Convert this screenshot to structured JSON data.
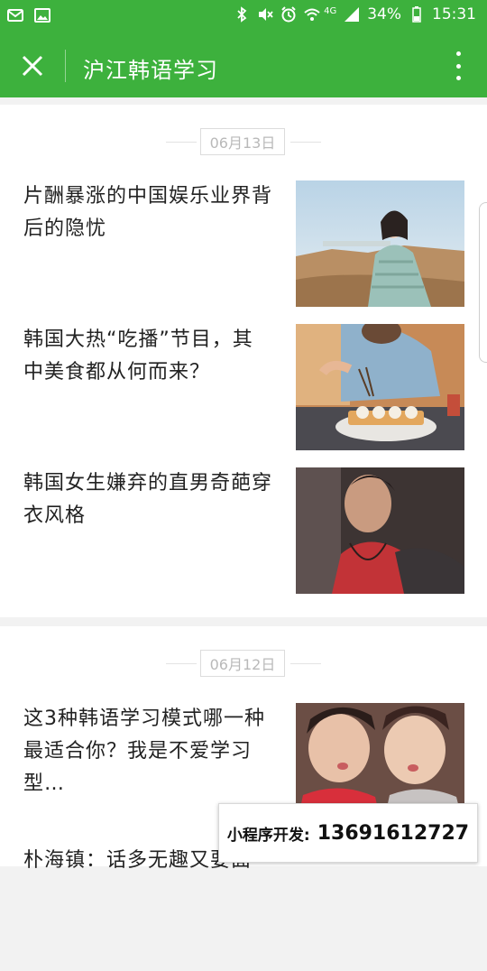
{
  "status_bar": {
    "battery": "34%",
    "time": "15:31",
    "network": "4G",
    "icons": [
      "mail-icon",
      "image-icon",
      "bluetooth-icon",
      "mute-icon",
      "alarm-icon",
      "wifi-icon",
      "signal-icon",
      "battery-icon"
    ]
  },
  "nav": {
    "title": "沪江韩语学习",
    "close_icon": "close-icon",
    "more_icon": "more-vertical-icon",
    "bar_color": "#3db13d"
  },
  "sections": [
    {
      "date": "06月13日",
      "articles": [
        {
          "title": "片酬暴涨的中国娱乐业界背后的隐忧",
          "thumb": "woman-pointing-in-desert-photo"
        },
        {
          "title": "韩国大热“吃播”节目，其中美食都从何而来？",
          "thumb": "person-eating-sushi-photo"
        },
        {
          "title": "韩国女生嫌弃的直男奇葩穿衣风格",
          "thumb": "man-in-red-shirt-photo"
        }
      ]
    },
    {
      "date": "06月12日",
      "articles": [
        {
          "title": "这3种韩语学习模式哪一种最适合你？我是不爱学习型…",
          "thumb": "two-young-men-selfie-photo"
        },
        {
          "title": "朴海镇：话多无趣又要面",
          "thumb": ""
        }
      ]
    }
  ],
  "ad_banner": {
    "label": "小程序开发:",
    "phone": "13691612727"
  }
}
